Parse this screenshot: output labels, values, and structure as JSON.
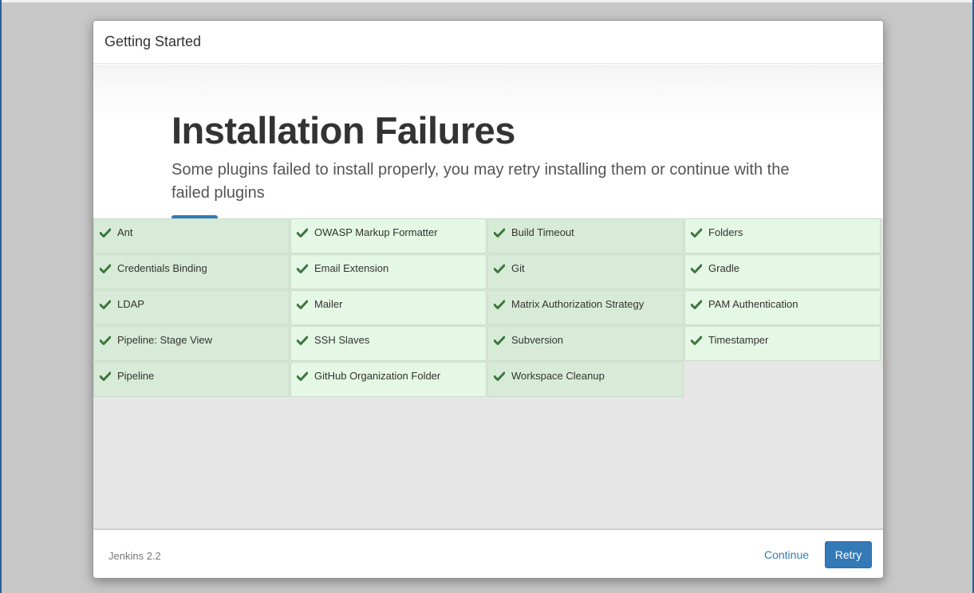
{
  "window": {
    "title": "Getting Started"
  },
  "hero": {
    "title": "Installation Failures",
    "subtitle": "Some plugins failed to install properly, you may retry installing them or continue with the failed plugins"
  },
  "plugins": {
    "columns": [
      [
        "Ant",
        "Credentials Binding",
        "LDAP",
        "Pipeline: Stage View",
        "Pipeline"
      ],
      [
        "OWASP Markup Formatter",
        "Email Extension",
        "Mailer",
        "SSH Slaves",
        "GitHub Organization Folder"
      ],
      [
        "Build Timeout",
        "Git",
        "Matrix Authorization Strategy",
        "Subversion",
        "Workspace Cleanup"
      ],
      [
        "Folders",
        "Gradle",
        "PAM Authentication",
        "Timestamper"
      ]
    ],
    "status_icon": "check-icon",
    "colors": {
      "check": "#3c763d",
      "row_dark": "#d8ebd8",
      "row_light": "#e5f7e5"
    }
  },
  "footer": {
    "version": "Jenkins 2.2",
    "continue_label": "Continue",
    "retry_label": "Retry"
  },
  "colors": {
    "accent": "#337ab7"
  }
}
